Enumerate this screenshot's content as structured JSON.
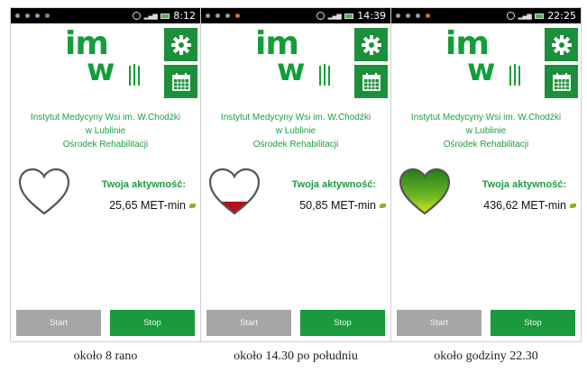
{
  "colors": {
    "brand_green": "#139e3a",
    "button_green": "#1a9a3c",
    "start_gray": "#a6a6a6",
    "status_bar": "#000000"
  },
  "logo": {
    "text_top": "im",
    "text_bottom": "w"
  },
  "institute": {
    "line1": "Instytut Medycyny Wsi im. W.Chodźki",
    "line2": "w Lublinie",
    "line3": "Ośrodek Rehabilitacji"
  },
  "icons": {
    "settings": "gear-icon",
    "calendar": "calendar-icon",
    "heart": "heart-icon",
    "leaf": "leaf-icon"
  },
  "screens": [
    {
      "time": "8:12",
      "activity_label": "Twoja aktywność:",
      "activity_value": "25,65 MET-min",
      "heart_fill_fraction": 0.0,
      "heart_fill_color": "#ffffff",
      "start_label": "Start",
      "stop_label": "Stop",
      "caption": "około 8 rano"
    },
    {
      "time": "14:39",
      "activity_label": "Twoja aktywność:",
      "activity_value": "50,85 MET-min",
      "heart_fill_fraction": 0.3,
      "heart_fill_color": "#b50f1c",
      "start_label": "Start",
      "stop_label": "Stop",
      "caption": "około 14.30 po południu"
    },
    {
      "time": "22:25",
      "activity_label": "Twoja aktywność:",
      "activity_value": "436,62 MET-min",
      "heart_fill_fraction": 1.0,
      "heart_fill_color": "#2e8b1f",
      "start_label": "Start",
      "stop_label": "Stop",
      "caption": "około godziny 22.30"
    }
  ]
}
